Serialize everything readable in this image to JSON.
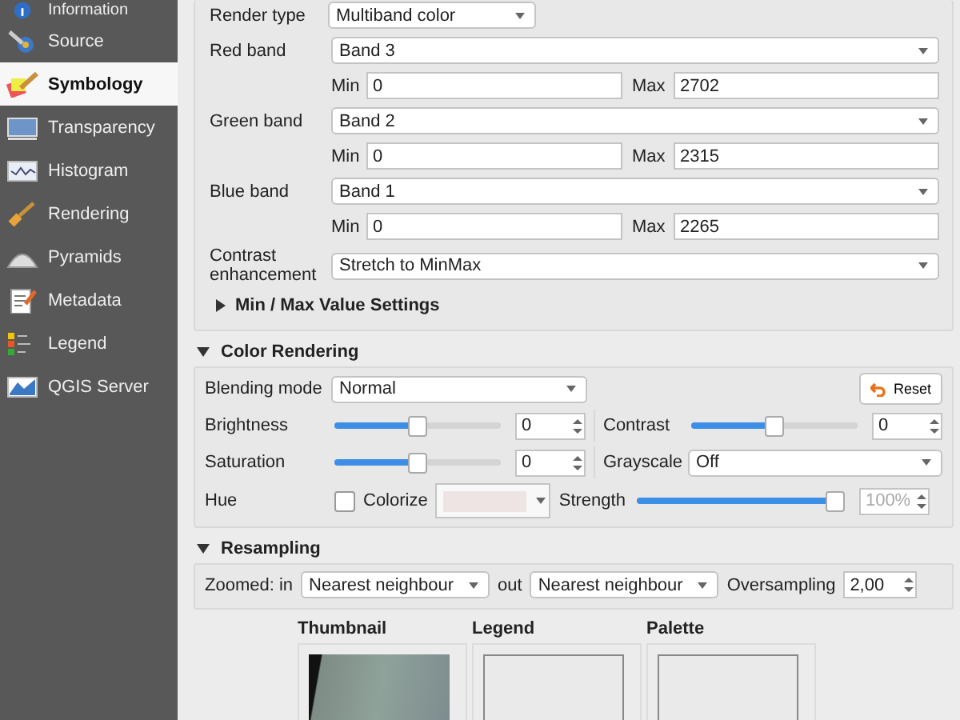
{
  "sidebar": {
    "items": [
      {
        "label": "Information",
        "selected": false
      },
      {
        "label": "Source",
        "selected": false
      },
      {
        "label": "Symbology",
        "selected": true
      },
      {
        "label": "Transparency",
        "selected": false
      },
      {
        "label": "Histogram",
        "selected": false
      },
      {
        "label": "Rendering",
        "selected": false
      },
      {
        "label": "Pyramids",
        "selected": false
      },
      {
        "label": "Metadata",
        "selected": false
      },
      {
        "label": "Legend",
        "selected": false
      },
      {
        "label": "QGIS Server",
        "selected": false
      }
    ]
  },
  "band_rendering": {
    "render_type": {
      "label": "Render type",
      "value": "Multiband color"
    },
    "bands": [
      {
        "label": "Red band",
        "value": "Band 3",
        "min_label": "Min",
        "min": "0",
        "max_label": "Max",
        "max": "2702"
      },
      {
        "label": "Green band",
        "value": "Band 2",
        "min_label": "Min",
        "min": "0",
        "max_label": "Max",
        "max": "2315"
      },
      {
        "label": "Blue band",
        "value": "Band 1",
        "min_label": "Min",
        "min": "0",
        "max_label": "Max",
        "max": "2265"
      }
    ],
    "contrast": {
      "label": "Contrast enhancement",
      "value": "Stretch to MinMax"
    },
    "minmax_settings": {
      "label": "Min / Max Value Settings",
      "expanded": false
    }
  },
  "color_rendering": {
    "title": "Color Rendering",
    "expanded": true,
    "blending": {
      "label": "Blending mode",
      "value": "Normal"
    },
    "reset": "Reset",
    "brightness": {
      "label": "Brightness",
      "level": 0.5,
      "value": "0"
    },
    "contrast": {
      "label": "Contrast",
      "level": 0.5,
      "value": "0"
    },
    "saturation": {
      "label": "Saturation",
      "level": 0.5,
      "value": "0"
    },
    "grayscale": {
      "label": "Grayscale",
      "value": "Off"
    },
    "hue": {
      "label": "Hue"
    },
    "colorize": {
      "label": "Colorize",
      "checked": false
    },
    "strength": {
      "label": "Strength",
      "level": 1,
      "value": "100%",
      "disabled": true
    }
  },
  "resampling": {
    "title": "Resampling",
    "expanded": true,
    "zoomed_in_label": "Zoomed: in",
    "zoomed_in": "Nearest neighbour",
    "out_label": "out",
    "zoomed_out": "Nearest neighbour",
    "oversampling_label": "Oversampling",
    "oversampling": "2,00"
  },
  "previews": [
    {
      "title": "Thumbnail",
      "kind": "image"
    },
    {
      "title": "Legend",
      "kind": "empty"
    },
    {
      "title": "Palette",
      "kind": "empty"
    }
  ]
}
